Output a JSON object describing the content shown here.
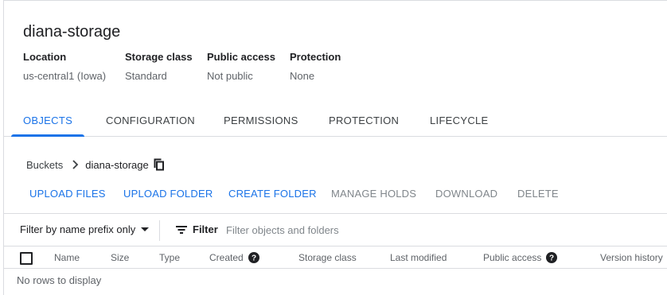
{
  "bucket": {
    "name": "diana-storage",
    "meta": [
      {
        "label": "Location",
        "value": "us-central1 (Iowa)"
      },
      {
        "label": "Storage class",
        "value": "Standard"
      },
      {
        "label": "Public access",
        "value": "Not public"
      },
      {
        "label": "Protection",
        "value": "None"
      }
    ]
  },
  "tabs": [
    "OBJECTS",
    "CONFIGURATION",
    "PERMISSIONS",
    "PROTECTION",
    "LIFECYCLE"
  ],
  "active_tab": "OBJECTS",
  "breadcrumb": {
    "root": "Buckets",
    "current": "diana-storage"
  },
  "actions": {
    "upload_files": "UPLOAD FILES",
    "upload_folder": "UPLOAD FOLDER",
    "create_folder": "CREATE FOLDER",
    "manage_holds": "MANAGE HOLDS",
    "download": "DOWNLOAD",
    "delete": "DELETE"
  },
  "filter": {
    "mode": "Filter by name prefix only",
    "label": "Filter",
    "placeholder": "Filter objects and folders"
  },
  "table": {
    "columns": [
      "Name",
      "Size",
      "Type",
      "Created",
      "Storage class",
      "Last modified",
      "Public access",
      "Version history"
    ],
    "empty_text": "No rows to display"
  },
  "colors": {
    "accent": "#1a73e8",
    "disabled": "#80868b",
    "divider": "#dadce0"
  }
}
